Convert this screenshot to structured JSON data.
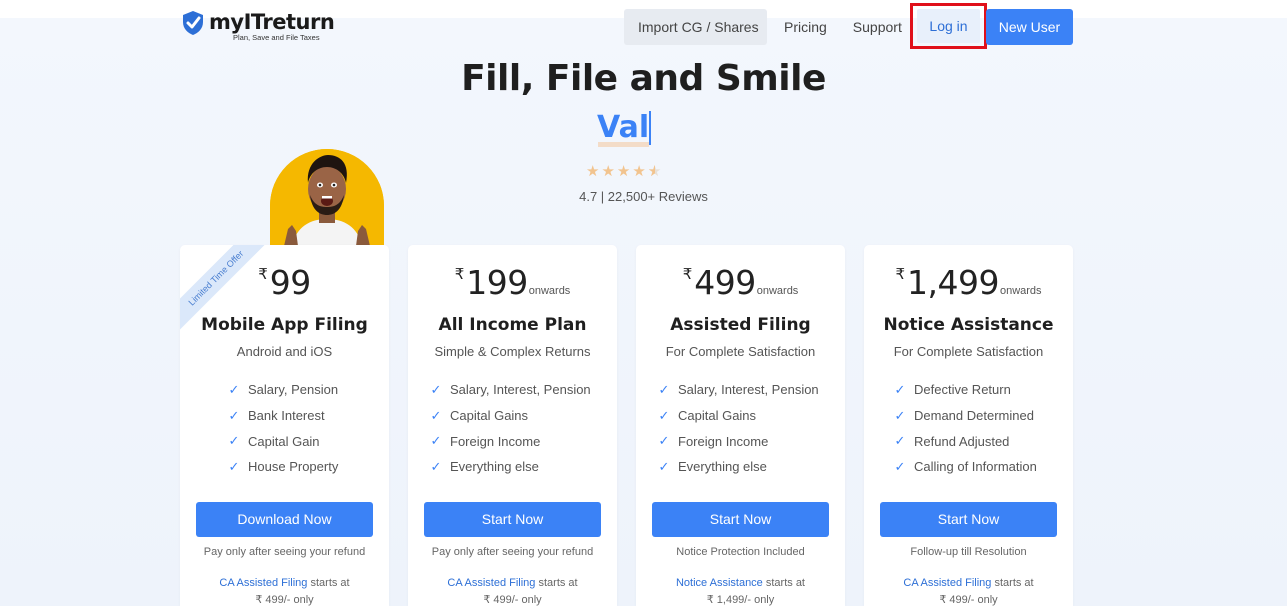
{
  "brand": {
    "name": "myITreturn",
    "tagline": "Plan, Save and File Taxes",
    "accent": "#3b82f6"
  },
  "nav": {
    "import": "Import CG / Shares",
    "pricing": "Pricing",
    "support": "Support",
    "login": "Log in",
    "new_user": "New User"
  },
  "hero": {
    "title": "Fill, File and Smile",
    "typed_text": "Val",
    "rating": "4.7 | 22,500+ Reviews",
    "stars": 4.5
  },
  "cards": [
    {
      "ribbon": "Limited Time Offer",
      "currency": "₹",
      "price": "99",
      "suffix": "",
      "title": "Mobile App Filing",
      "subtitle": "Android and iOS",
      "features": [
        "Salary, Pension",
        "Bank Interest",
        "Capital Gain",
        "House Property"
      ],
      "cta": "Download Now",
      "note": "Pay only after seeing your refund",
      "assist_link": "CA Assisted Filing",
      "assist_text": " starts at",
      "assist_price": "₹ 499/- only"
    },
    {
      "currency": "₹",
      "price": "199",
      "suffix": "onwards",
      "title": "All Income Plan",
      "subtitle": "Simple & Complex Returns",
      "features": [
        "Salary, Interest, Pension",
        "Capital Gains",
        "Foreign Income",
        "Everything else"
      ],
      "cta": "Start Now",
      "note": "Pay only after seeing your refund",
      "assist_link": "CA Assisted Filing",
      "assist_text": " starts at",
      "assist_price": "₹ 499/- only"
    },
    {
      "currency": "₹",
      "price": "499",
      "suffix": "onwards",
      "title": "Assisted Filing",
      "subtitle": "For Complete Satisfaction",
      "features": [
        "Salary, Interest, Pension",
        "Capital Gains",
        "Foreign Income",
        "Everything else"
      ],
      "cta": "Start Now",
      "note": "Notice Protection Included",
      "assist_link": "Notice Assistance",
      "assist_text": " starts at",
      "assist_price": "₹ 1,499/- only"
    },
    {
      "currency": "₹",
      "price": "1,499",
      "suffix": "onwards",
      "title": "Notice Assistance",
      "subtitle": "For Complete Satisfaction",
      "features": [
        "Defective Return",
        "Demand Determined",
        "Refund Adjusted",
        "Calling of Information"
      ],
      "cta": "Start Now",
      "note": "Follow-up till Resolution",
      "assist_link": "CA Assisted Filing",
      "assist_text": " starts at",
      "assist_price": "₹ 499/- only"
    }
  ]
}
